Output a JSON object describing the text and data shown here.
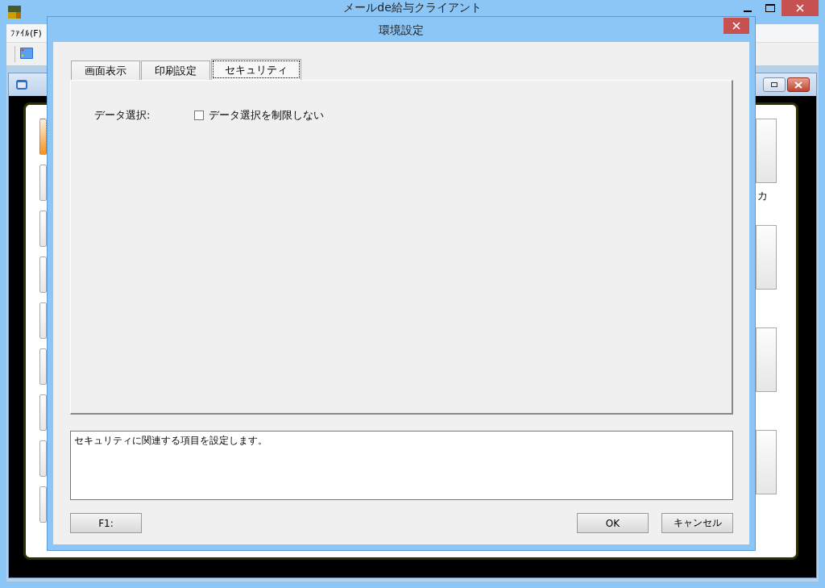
{
  "main_window": {
    "title": "メールde給与クライアント",
    "menu": [
      {
        "label": "ﾌｧｲﾙ(F)"
      }
    ]
  },
  "child_window": {
    "launcher_buttons": [
      {
        "selected": true
      },
      {
        "selected": false
      },
      {
        "selected": false
      },
      {
        "selected": false
      },
      {
        "selected": false
      },
      {
        "selected": false
      },
      {
        "selected": false
      },
      {
        "selected": false
      },
      {
        "selected": false
      }
    ],
    "side_label": "カ"
  },
  "dialog": {
    "title": "環境設定",
    "tabs": [
      {
        "label": "画面表示",
        "selected": false
      },
      {
        "label": "印刷設定",
        "selected": false
      },
      {
        "label": "セキュリティ",
        "selected": true
      }
    ],
    "fields": [
      {
        "label": "データ選択:",
        "checkbox": {
          "label": "データ選択を制限しない",
          "checked": false
        }
      }
    ],
    "description": "セキュリティに関連する項目を設定します。",
    "help_button": "F1:",
    "buttons": [
      "OK",
      "キャンセル"
    ]
  }
}
